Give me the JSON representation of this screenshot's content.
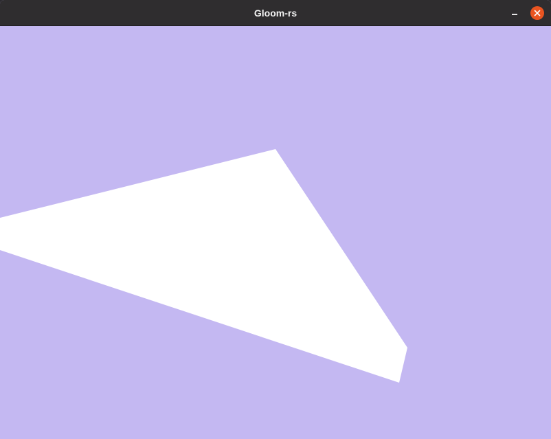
{
  "window": {
    "title": "Gloom-rs",
    "titlebar_color": "#2f2d2f",
    "close_button_color": "#e95420"
  },
  "controls": {
    "minimize_icon": "minimize-icon",
    "close_icon": "close-icon"
  },
  "scene": {
    "background_color": "#c4b8f2",
    "shape": "quadrilateral",
    "shape_color": "#ffffff"
  }
}
